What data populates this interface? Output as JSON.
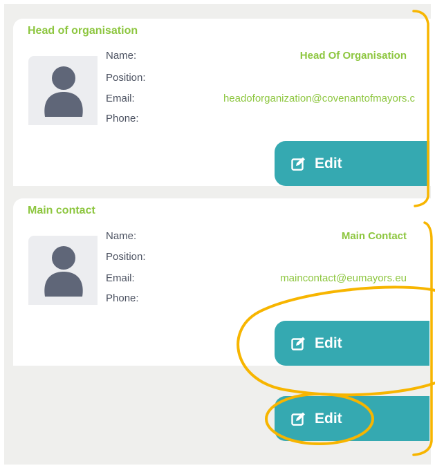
{
  "cards": [
    {
      "title": "Head of organisation",
      "labels": [
        "Name:",
        "Position:",
        "Email:",
        "Phone:"
      ],
      "name": "Head Of Organisation",
      "position": "",
      "email": "headoforganization@covenantofmayors.c",
      "phone": "",
      "edit_label": "Edit"
    },
    {
      "title": "Main contact",
      "labels": [
        "Name:",
        "Position:",
        "Email:",
        "Phone:"
      ],
      "name": "Main Contact",
      "position": "",
      "email": "maincontact@eumayors.eu",
      "phone": "",
      "edit_label": "Edit"
    }
  ],
  "standalone_edit_label": "Edit",
  "colors": {
    "accent_green": "#8dc63f",
    "button_teal": "#35a9b1",
    "annotation_yellow": "#f7b500",
    "label_gray": "#4b5160",
    "panel_bg": "#efefed"
  },
  "icons": [
    "avatar-icon",
    "edit-icon"
  ]
}
